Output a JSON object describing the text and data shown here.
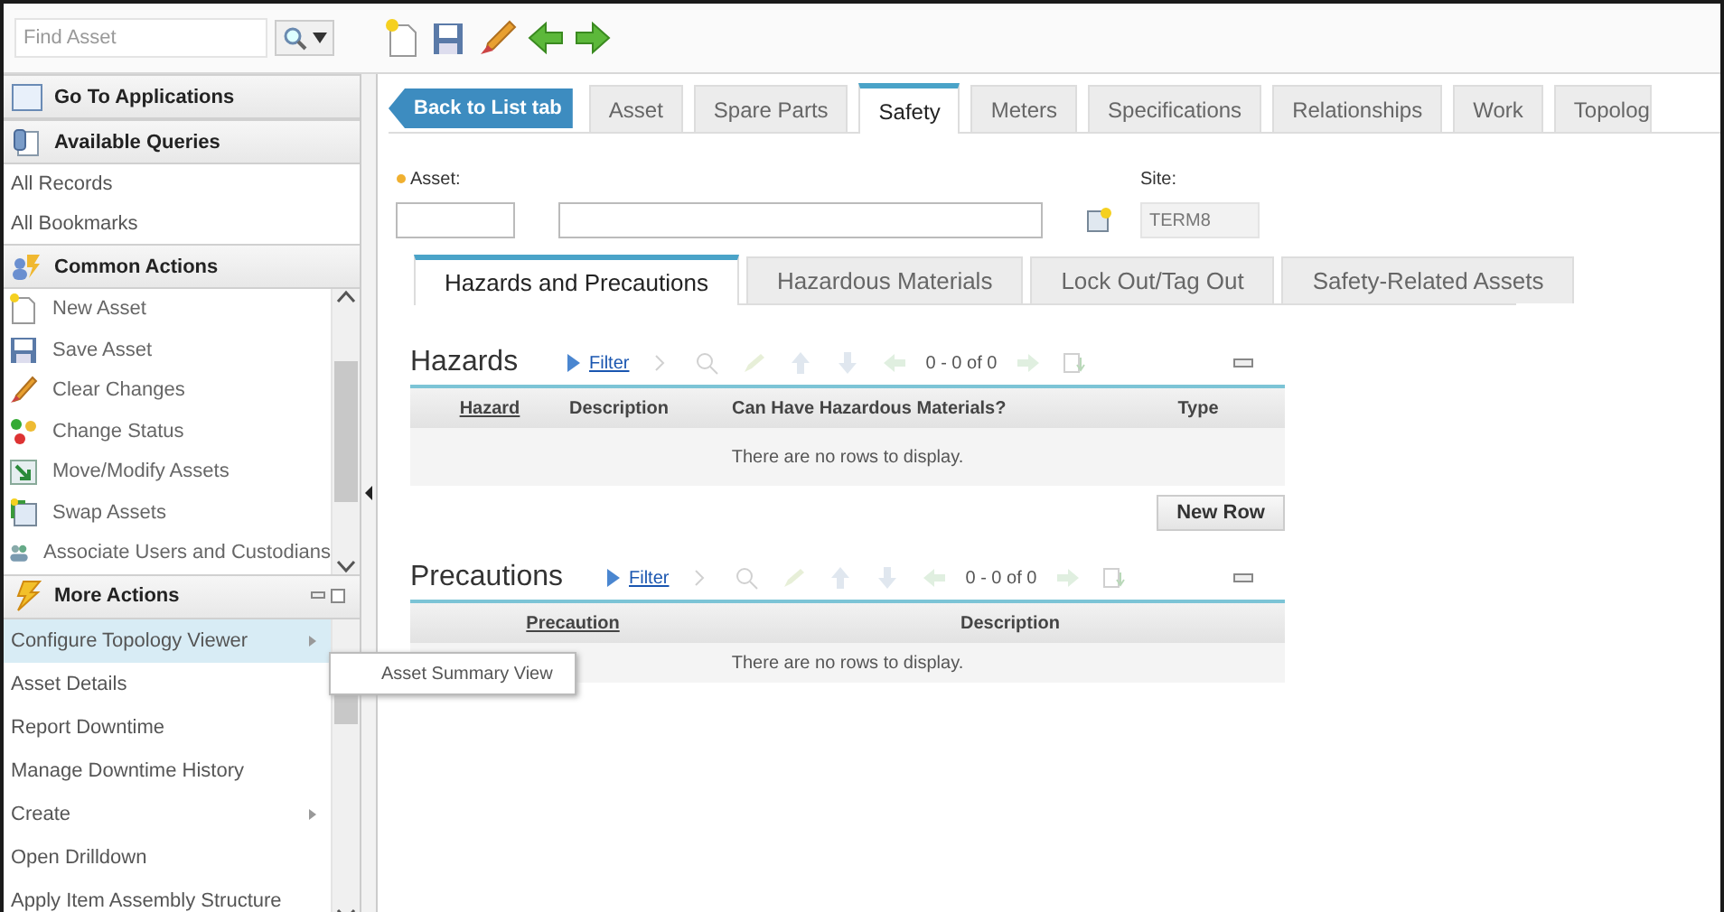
{
  "search": {
    "placeholder": "Find Asset"
  },
  "sidebar": {
    "sections": [
      {
        "title": "Go To Applications",
        "kind": "window"
      },
      {
        "title": "Available Queries",
        "kind": "query",
        "items": [
          {
            "label": "All Records"
          },
          {
            "label": "All Bookmarks"
          }
        ]
      },
      {
        "title": "Common Actions",
        "kind": "actions",
        "items": [
          {
            "label": "New Asset",
            "kind": "new"
          },
          {
            "label": "Save Asset",
            "kind": "save"
          },
          {
            "label": "Clear Changes",
            "kind": "clear"
          },
          {
            "label": "Change Status",
            "kind": "status"
          },
          {
            "label": "Move/Modify Assets",
            "kind": "move"
          },
          {
            "label": "Swap Assets",
            "kind": "swap"
          },
          {
            "label": "Associate Users and Custodians",
            "kind": "users"
          }
        ]
      },
      {
        "title": "More Actions",
        "kind": "bolt",
        "items": [
          {
            "label": "Configure Topology Viewer",
            "submenu": true,
            "selected": true
          },
          {
            "label": "Asset Details",
            "submenu": false,
            "selected": false
          },
          {
            "label": "Report Downtime",
            "submenu": false,
            "selected": false
          },
          {
            "label": "Manage Downtime History",
            "submenu": false,
            "selected": false
          },
          {
            "label": "Create",
            "submenu": true,
            "selected": false
          },
          {
            "label": "Open Drilldown",
            "submenu": false,
            "selected": false
          },
          {
            "label": "Apply Item Assembly Structure",
            "submenu": false,
            "selected": false
          }
        ]
      }
    ]
  },
  "submenu": {
    "items": [
      "Asset Summary View"
    ]
  },
  "back_button": "Back to List tab",
  "tabs": [
    {
      "label": "Asset",
      "selected": false
    },
    {
      "label": "Spare Parts",
      "selected": false
    },
    {
      "label": "Safety",
      "selected": true
    },
    {
      "label": "Meters",
      "selected": false
    },
    {
      "label": "Specifications",
      "selected": false
    },
    {
      "label": "Relationships",
      "selected": false
    },
    {
      "label": "Work",
      "selected": false
    },
    {
      "label": "Topolog",
      "selected": false
    }
  ],
  "fields": {
    "asset_label": "Asset:",
    "asset_required": true,
    "site_label": "Site:",
    "site_value": "TERM8"
  },
  "subtabs": [
    {
      "label": "Hazards and Precautions",
      "selected": true
    },
    {
      "label": "Hazardous Materials",
      "selected": false
    },
    {
      "label": "Lock Out/Tag Out",
      "selected": false
    },
    {
      "label": "Safety-Related Assets",
      "selected": false
    }
  ],
  "tables": [
    {
      "kind": "hazards",
      "title": "Hazards",
      "filter": "Filter",
      "pagination": "0 - 0 of 0",
      "columns": [
        {
          "label": "Hazard",
          "link": true
        },
        {
          "label": "Description",
          "link": false
        },
        {
          "label": "Can Have Hazardous Materials?",
          "link": false
        },
        {
          "label": "Type",
          "link": false
        }
      ],
      "empty_message": "There are no rows to display.",
      "button": "New Row"
    },
    {
      "kind": "precautions",
      "title": "Precautions",
      "filter": "Filter",
      "pagination": "0 - 0 of 0",
      "columns": [
        {
          "label": "Precaution",
          "link": true
        },
        {
          "label": "Description",
          "link": false
        }
      ],
      "empty_message": "There are no rows to display."
    }
  ]
}
